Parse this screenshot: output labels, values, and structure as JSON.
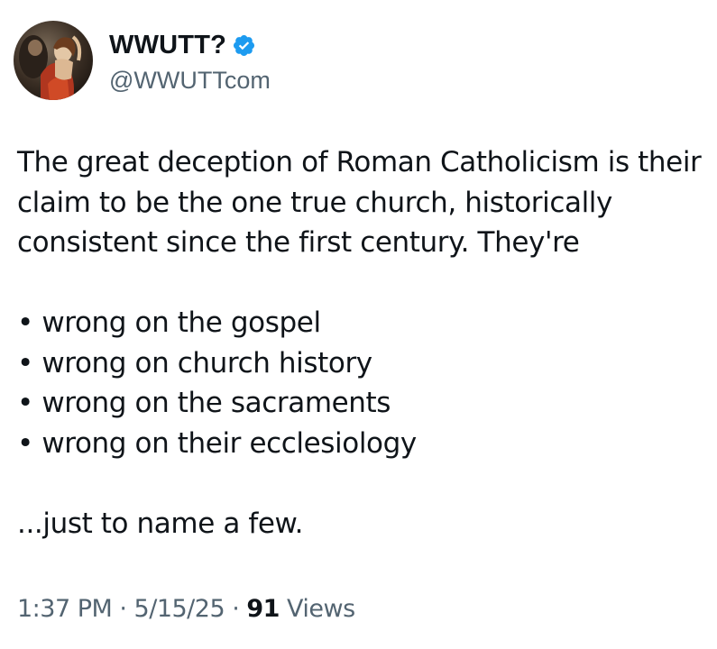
{
  "author": {
    "display_name": "WWUTT?",
    "handle": "@WWUTTcom",
    "verified_color": "#1d9bf0",
    "avatar_icon": "classical-painting-avatar"
  },
  "tweet": {
    "intro": "The great deception of Roman Catholicism is their claim to be the one true church, historically consistent since the first century. They're",
    "bullets": [
      "• wrong on the gospel",
      "• wrong on church history",
      "• wrong on the sacraments",
      "• wrong on their ecclesiology"
    ],
    "outro": "...just to name a few."
  },
  "meta": {
    "time": "1:37 PM",
    "separator": " · ",
    "date": "5/15/25",
    "views_count": "91",
    "views_label": " Views"
  }
}
